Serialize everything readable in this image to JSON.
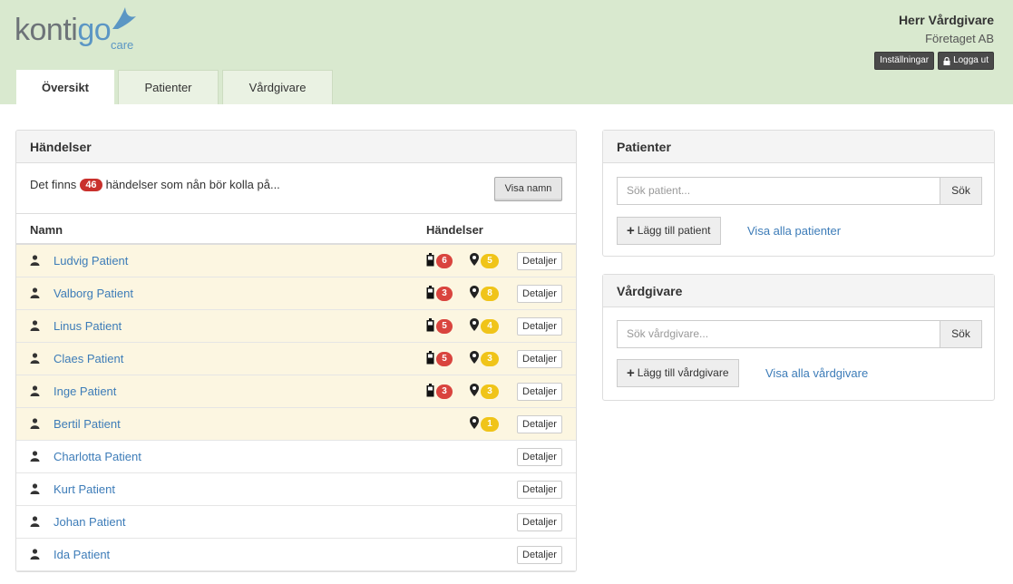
{
  "brand": {
    "logo_main": "kontigo",
    "logo_sub": "care",
    "accent": "#5b96c4",
    "header_bg": "#d9e9cf"
  },
  "user": {
    "name": "Herr Vårdgivare",
    "company": "Företaget AB",
    "settings_label": "Inställningar",
    "logout_label": "Logga ut"
  },
  "tabs": [
    {
      "label": "Översikt",
      "active": true
    },
    {
      "label": "Patienter",
      "active": false
    },
    {
      "label": "Vårdgivare",
      "active": false
    }
  ],
  "events_panel": {
    "title": "Händelser",
    "info_prefix": "Det finns",
    "info_count": "46",
    "info_suffix": "händelser som nån bör kolla på...",
    "show_names_label": "Visa namn",
    "col_name": "Namn",
    "col_events": "Händelser",
    "details_label": "Detaljer",
    "rows": [
      {
        "name": "Ludvig Patient",
        "battery": "6",
        "location": "5",
        "highlight": true
      },
      {
        "name": "Valborg Patient",
        "battery": "3",
        "location": "8",
        "highlight": true
      },
      {
        "name": "Linus Patient",
        "battery": "5",
        "location": "4",
        "highlight": true
      },
      {
        "name": "Claes Patient",
        "battery": "5",
        "location": "3",
        "highlight": true
      },
      {
        "name": "Inge Patient",
        "battery": "3",
        "location": "3",
        "highlight": true
      },
      {
        "name": "Bertil Patient",
        "battery": null,
        "location": "1",
        "highlight": true
      },
      {
        "name": "Charlotta Patient",
        "battery": null,
        "location": null,
        "highlight": false
      },
      {
        "name": "Kurt Patient",
        "battery": null,
        "location": null,
        "highlight": false
      },
      {
        "name": "Johan Patient",
        "battery": null,
        "location": null,
        "highlight": false
      },
      {
        "name": "Ida Patient",
        "battery": null,
        "location": null,
        "highlight": false
      }
    ]
  },
  "patients_panel": {
    "title": "Patienter",
    "search_placeholder": "Sök patient...",
    "search_label": "Sök",
    "add_label": "Lägg till patient",
    "show_all_label": "Visa alla patienter"
  },
  "caregivers_panel": {
    "title": "Vårdgivare",
    "search_placeholder": "Sök vårdgivare...",
    "search_label": "Sök",
    "add_label": "Lägg till vårdgivare",
    "show_all_label": "Visa alla vårdgivare"
  }
}
